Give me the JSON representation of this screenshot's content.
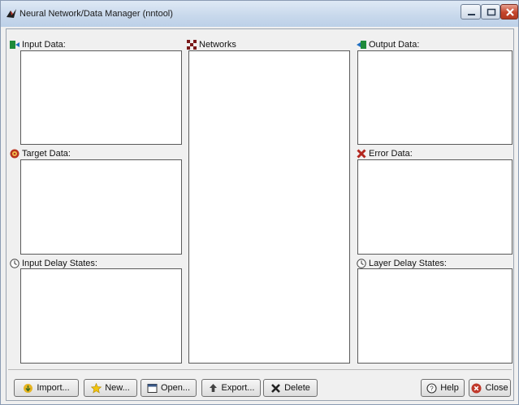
{
  "window": {
    "title": "Neural Network/Data Manager (nntool)",
    "icon": "matlab-logo-icon"
  },
  "panels": {
    "input_data": {
      "label": "Input Data:",
      "icon": "input-data-icon",
      "items": []
    },
    "target_data": {
      "label": "Target Data:",
      "icon": "target-icon",
      "items": []
    },
    "input_delay_states": {
      "label": "Input Delay States:",
      "icon": "delay-clock-icon",
      "items": []
    },
    "networks": {
      "label": "Networks",
      "icon": "network-icon",
      "items": []
    },
    "output_data": {
      "label": "Output Data:",
      "icon": "output-data-icon",
      "items": []
    },
    "error_data": {
      "label": "Error Data:",
      "icon": "error-x-icon",
      "items": []
    },
    "layer_delay_states": {
      "label": "Layer Delay States:",
      "icon": "delay-clock-icon",
      "items": []
    }
  },
  "buttons": {
    "import": "Import...",
    "new": "New...",
    "open": "Open...",
    "export": "Export...",
    "delete": "Delete",
    "help": "Help",
    "close": "Close"
  },
  "colors": {
    "titlebar": "#c9d9ec",
    "window_bg": "#f0f0f0",
    "listbox_bg": "#ffffff",
    "close_button": "#c4452c"
  }
}
